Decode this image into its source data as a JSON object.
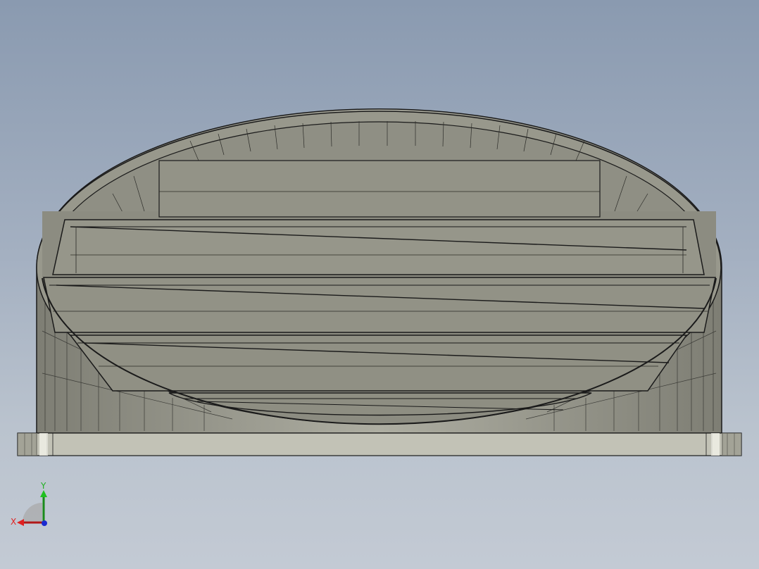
{
  "viewport": {
    "background_top": "#8a9ab0",
    "background_bottom": "#c3cad4"
  },
  "model": {
    "name": "louvered-round-vent",
    "fill_color": "#8f8f83",
    "edge_color": "#1a1a1a",
    "base_color": "#c2c2b6",
    "louver_count": 4
  },
  "triad": {
    "x_label": "X",
    "y_label": "Y",
    "x_color": "#e02020",
    "y_color": "#20c020",
    "z_color": "#1a2ad0"
  }
}
